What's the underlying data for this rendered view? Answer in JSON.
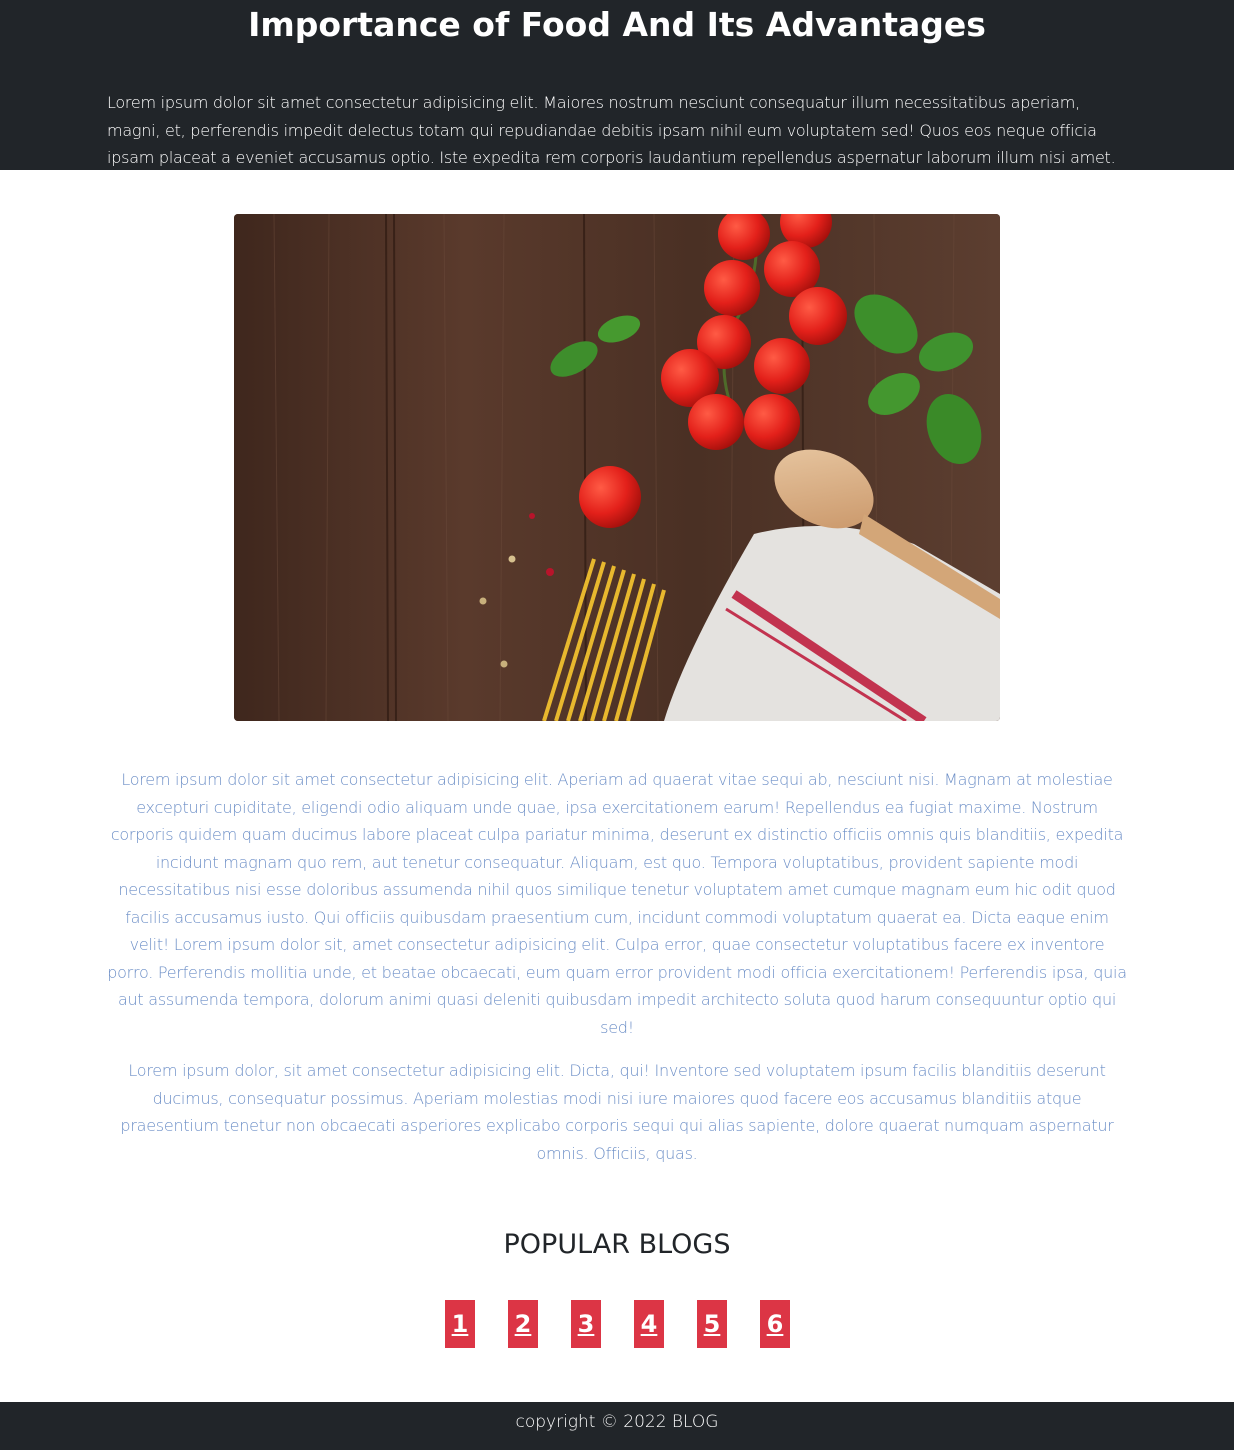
{
  "header": {
    "title": "Importance of Food And Its Advantages",
    "intro": "Lorem ipsum dolor sit amet consectetur adipisicing elit. Maiores nostrum nesciunt consequatur illum necessitatibus aperiam, magni, et, perferendis impedit delectus totam qui repudiandae debitis ipsam nihil eum voluptatem sed! Quos eos neque officia ipsam placeat a eveniet accusamus optio. Iste expedita rem corporis laudantium repellendus aspernatur laborum illum nisi amet."
  },
  "article": {
    "paragraphs": [
      "Lorem ipsum dolor sit amet consectetur adipisicing elit. Aperiam ad quaerat vitae sequi ab, nesciunt nisi. Magnam at molestiae excepturi cupiditate, eligendi odio aliquam unde quae, ipsa exercitationem earum! Repellendus ea fugiat maxime. Nostrum corporis quidem quam ducimus labore placeat culpa pariatur minima, deserunt ex distinctio officiis omnis quis blanditiis, expedita incidunt magnam quo rem, aut tenetur consequatur. Aliquam, est quo. Tempora voluptatibus, provident sapiente modi necessitatibus nisi esse doloribus assumenda nihil quos similique tenetur voluptatem amet cumque magnam eum hic odit quod facilis accusamus iusto. Qui officiis quibusdam praesentium cum, incidunt commodi voluptatum quaerat ea. Dicta eaque enim velit! Lorem ipsum dolor sit, amet consectetur adipisicing elit. Culpa error, quae consectetur voluptatibus facere ex inventore porro. Perferendis mollitia unde, et beatae obcaecati, eum quam error provident modi officia exercitationem! Perferendis ipsa, quia aut assumenda tempora, dolorum animi quasi deleniti quibusdam impedit architecto soluta quod harum consequuntur optio qui sed!",
      "Lorem ipsum dolor, sit amet consectetur adipisicing elit. Dicta, qui! Inventore sed voluptatem ipsum facilis blanditiis deserunt ducimus, consequatur possimus. Aperiam molestias modi nisi iure maiores quod facere eos accusamus blanditiis atque praesentium tenetur non obcaecati asperiores explicabo corporis sequi qui alias sapiente, dolore quaerat numquam aspernatur omnis. Officiis, quas."
    ]
  },
  "popular": {
    "heading": "POPULAR BLOGS",
    "pages": [
      "1",
      "2",
      "3",
      "4",
      "5",
      "6"
    ]
  },
  "footer": {
    "copyright": "copyright © 2022 BLOG"
  },
  "colors": {
    "dark": "#212529",
    "accent": "#dc3545",
    "body_text": "#6d8fc7"
  }
}
